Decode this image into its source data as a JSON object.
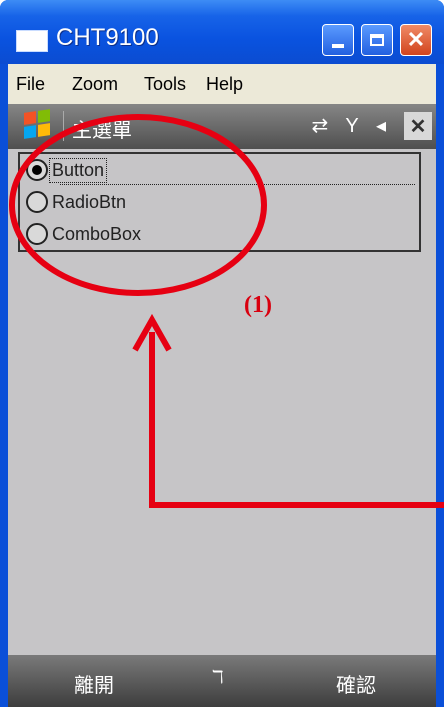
{
  "window": {
    "title": "CHT9100"
  },
  "menubar": {
    "items": [
      "File",
      "Zoom",
      "Tools",
      "Help"
    ]
  },
  "device": {
    "caption": "主選單",
    "status_icons": "⇄ Y ◂",
    "close_label": "✕",
    "options": [
      {
        "label": "Button",
        "selected": true
      },
      {
        "label": "RadioBtn",
        "selected": false
      },
      {
        "label": "ComboBox",
        "selected": false
      }
    ],
    "softkeys": {
      "left": "離開",
      "right": "確認",
      "keyboard": "ℸ"
    }
  },
  "annotation": {
    "label": "(1)",
    "color": "#e60012"
  }
}
